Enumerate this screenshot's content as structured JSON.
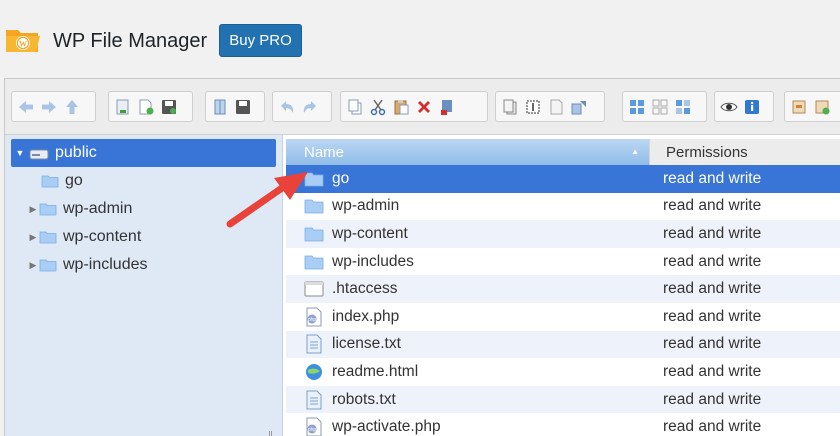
{
  "header": {
    "title": "WP File Manager",
    "buy_label": "Buy PRO"
  },
  "toolbar": {
    "groups": [
      [
        "back-icon",
        "forward-icon",
        "up-icon"
      ],
      [
        "download-icon",
        "new-file-icon",
        "save-icon"
      ],
      [
        "open-icon",
        "save-disk-icon"
      ],
      [
        "undo-icon",
        "redo-icon"
      ],
      [
        "copy-icon",
        "cut-icon",
        "paste-icon",
        "delete-icon",
        "empty-icon"
      ],
      [
        "duplicate-icon",
        "select-icon",
        "rename-icon",
        "extract-icon"
      ],
      [
        "view-icons-icon",
        "view-list-icon",
        "view-grid-icon"
      ],
      [
        "preview-icon",
        "info-icon"
      ],
      [
        "archive-icon",
        "extract-archive-icon"
      ]
    ]
  },
  "tree": {
    "root": "public",
    "items": [
      "go",
      "wp-admin",
      "wp-content",
      "wp-includes"
    ]
  },
  "files": {
    "columns": {
      "name": "Name",
      "permissions": "Permissions"
    },
    "rows": [
      {
        "name": "go",
        "perm": "read and write",
        "type": "folder"
      },
      {
        "name": "wp-admin",
        "perm": "read and write",
        "type": "folder"
      },
      {
        "name": "wp-content",
        "perm": "read and write",
        "type": "folder"
      },
      {
        "name": "wp-includes",
        "perm": "read and write",
        "type": "folder"
      },
      {
        "name": ".htaccess",
        "perm": "read and write",
        "type": "file"
      },
      {
        "name": "index.php",
        "perm": "read and write",
        "type": "php"
      },
      {
        "name": "license.txt",
        "perm": "read and write",
        "type": "text"
      },
      {
        "name": "readme.html",
        "perm": "read and write",
        "type": "html"
      },
      {
        "name": "robots.txt",
        "perm": "read and write",
        "type": "text"
      },
      {
        "name": "wp-activate.php",
        "perm": "read and write",
        "type": "php"
      }
    ]
  },
  "colors": {
    "accent": "#3875d7",
    "buy": "#2271b1",
    "annotation": "#e8423a"
  }
}
